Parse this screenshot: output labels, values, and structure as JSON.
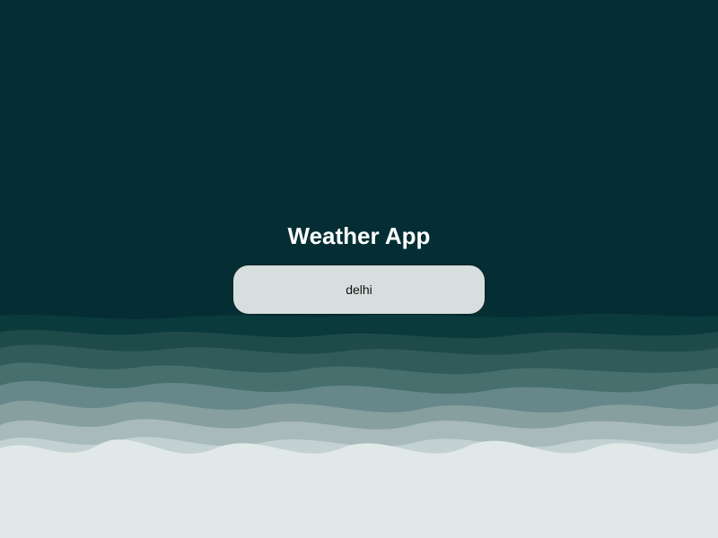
{
  "app": {
    "title": "Weather App"
  },
  "search": {
    "value": "delhi",
    "placeholder": ""
  },
  "colors": {
    "background": "#042e33",
    "wave_layers": [
      "#0b3a3d",
      "#1e4a4a",
      "#305b5a",
      "#476f6d",
      "#66888a",
      "#879f9f",
      "#a8baba",
      "#c3d1d2",
      "#e0e8e8"
    ],
    "input_background": "#d6dede",
    "title_text": "#ffffff"
  }
}
